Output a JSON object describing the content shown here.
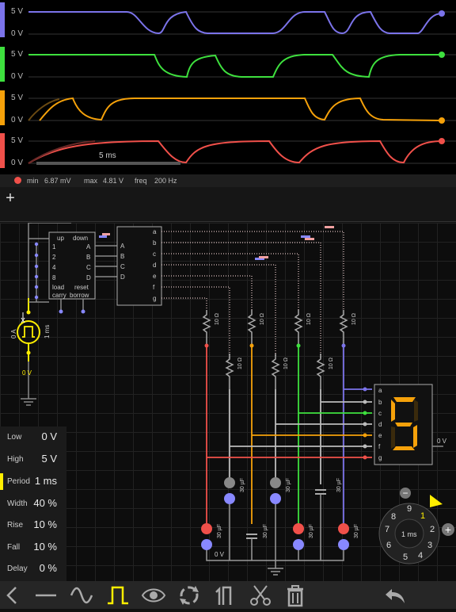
{
  "scope": {
    "channels": [
      {
        "name": "ch1",
        "high_label": "5 V",
        "low_label": "0 V",
        "color": "#7b73ea"
      },
      {
        "name": "ch2",
        "high_label": "5 V",
        "low_label": "0 V",
        "color": "#3ee03e"
      },
      {
        "name": "ch3",
        "high_label": "5 V",
        "low_label": "0 V",
        "color": "#f5a10a"
      },
      {
        "name": "ch4",
        "high_label": "5 V",
        "low_label": "0 V",
        "color": "#f0504a"
      }
    ],
    "time_label": "5 ms"
  },
  "status": {
    "min_label": "min",
    "min_value": "6.87 mV",
    "max_label": "max",
    "max_value": "4.81 V",
    "freq_label": "freq",
    "freq_value": "200 Hz"
  },
  "add_button": "+",
  "circuit": {
    "source_current": "0 A",
    "source_period": "1 ms",
    "source_voltage": "0 V",
    "counter": {
      "pins_left": [
        "1",
        "2",
        "4",
        "8"
      ],
      "up": "up",
      "down": "down",
      "A": "A",
      "B": "B",
      "C": "C",
      "D": "D",
      "load": "load",
      "reset": "reset",
      "carry": "carry",
      "borrow": "borrow"
    },
    "decoder": {
      "inputs": [
        "A",
        "B",
        "C",
        "D"
      ],
      "outputs": [
        "a",
        "b",
        "c",
        "d",
        "e",
        "f",
        "g"
      ]
    },
    "resistor_label": "10 Ω",
    "capacitor_label": "30 µF",
    "ground_label": "0 V",
    "display_pins": [
      "a",
      "b",
      "c",
      "d",
      "e",
      "f",
      "g"
    ],
    "display_out": "0 V",
    "display_digit": "5"
  },
  "params": [
    {
      "name": "Low",
      "value": "0 V"
    },
    {
      "name": "High",
      "value": "5 V"
    },
    {
      "name": "Period",
      "value": "1 ms",
      "selected": true
    },
    {
      "name": "Width",
      "value": "40 %"
    },
    {
      "name": "Rise",
      "value": "10 %"
    },
    {
      "name": "Fall",
      "value": "10 %"
    },
    {
      "name": "Delay",
      "value": "0 %"
    }
  ],
  "dial": {
    "numbers": [
      "1",
      "2",
      "3",
      "4",
      "5",
      "6",
      "7",
      "8",
      "9"
    ],
    "center": "1 ms",
    "minus": "−",
    "plus": "+"
  },
  "toolbar": [
    "back-icon",
    "wire-icon",
    "sine-icon",
    "pulse-icon",
    "eye-icon",
    "cycle-icon",
    "flip-icon",
    "cut-icon",
    "trash-icon",
    "undo-icon"
  ]
}
